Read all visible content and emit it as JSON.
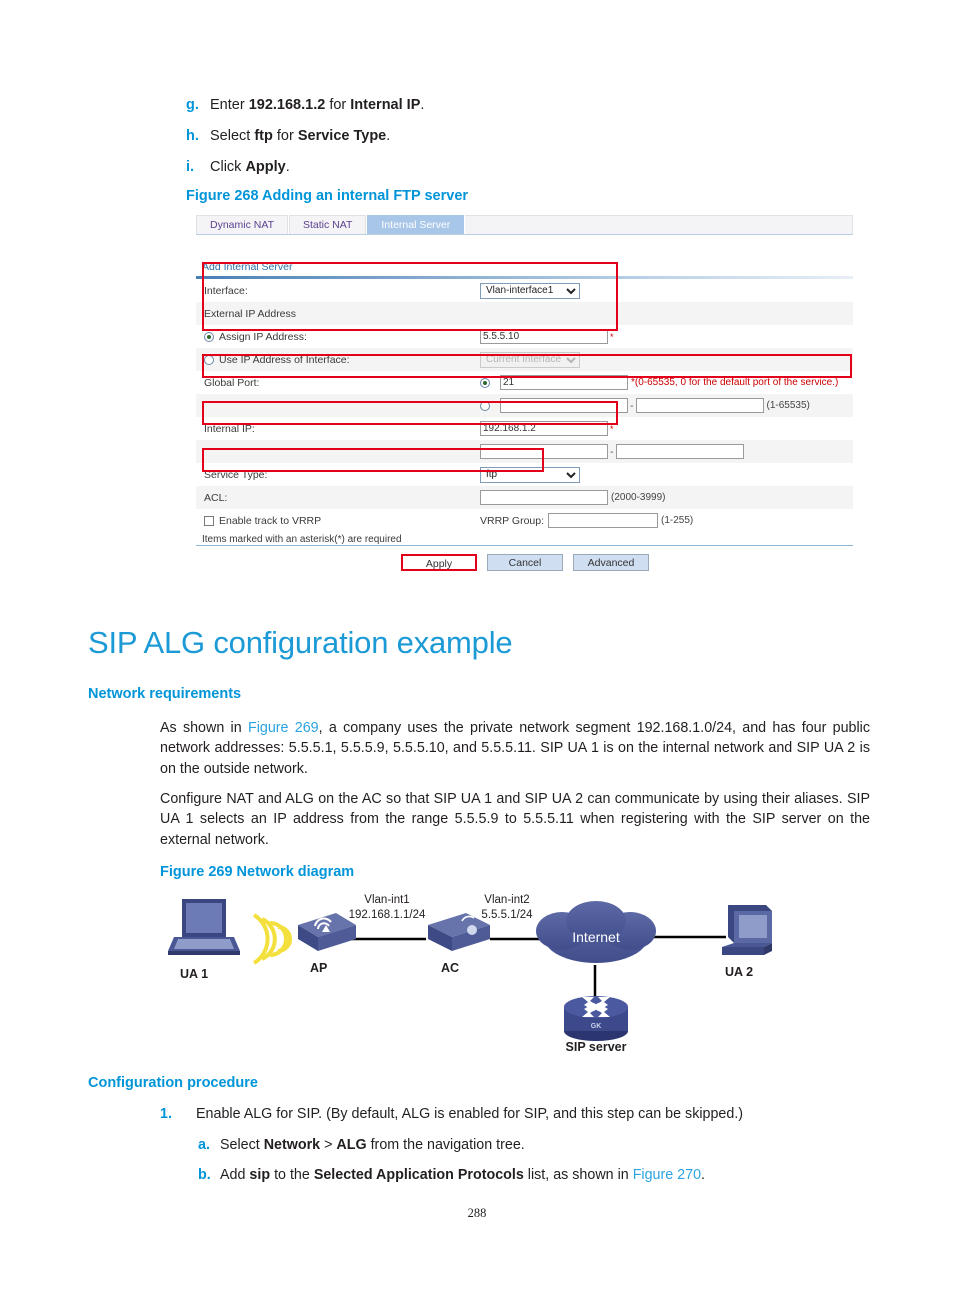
{
  "steps": [
    {
      "alpha": "g.",
      "parts": [
        {
          "t": "Enter ",
          "b": false
        },
        {
          "t": "192.168.1.2",
          "b": true
        },
        {
          "t": " for ",
          "b": false
        },
        {
          "t": "Internal IP",
          "b": true
        },
        {
          "t": ".",
          "b": false
        }
      ]
    },
    {
      "alpha": "h.",
      "parts": [
        {
          "t": "Select ",
          "b": false
        },
        {
          "t": "ftp",
          "b": true
        },
        {
          "t": " for ",
          "b": false
        },
        {
          "t": "Service Type",
          "b": true
        },
        {
          "t": ".",
          "b": false
        }
      ]
    },
    {
      "alpha": "i.",
      "parts": [
        {
          "t": "Click ",
          "b": false
        },
        {
          "t": "Apply",
          "b": true
        },
        {
          "t": ".",
          "b": false
        }
      ]
    }
  ],
  "figure268": {
    "caption": "Figure 268 Adding an internal FTP server",
    "tabs": [
      {
        "label": "Dynamic NAT",
        "active": false
      },
      {
        "label": "Static NAT",
        "active": false
      },
      {
        "label": "Internal Server",
        "active": true
      }
    ],
    "section_title": "Add Internal Server",
    "rows": {
      "interface_label": "Interface:",
      "interface_value": "Vlan-interface1",
      "external_ip_label": "External IP Address",
      "assign_ip_label": "Assign IP Address:",
      "assign_ip_value": "5.5.5.10",
      "use_ip_of_interface_label": "Use IP Address of Interface:",
      "current_interface_value": "Current Interface",
      "global_port_label": "Global Port:",
      "global_port_value": "21",
      "global_port_hint": "*(0-65535, 0 for the default port of the service.)",
      "port_range_hint": "(1-65535)",
      "port_range_from": "",
      "port_range_to": "",
      "internal_ip_label": "Internal IP:",
      "internal_ip_value": "192.168.1.2",
      "internal_ip_range_from": "",
      "internal_ip_range_to": "",
      "service_type_label": "Service Type:",
      "service_type_value": "ftp",
      "acl_label": "ACL:",
      "acl_value": "",
      "acl_hint": "(2000-3999)",
      "enable_track_vrrp_label": "Enable track to VRRP",
      "vrrp_group_label": "VRRP Group:",
      "vrrp_group_value": "",
      "vrrp_group_hint": "(1-255)"
    },
    "footnote": "Items marked with an asterisk(*) are required",
    "buttons": {
      "apply": "Apply",
      "cancel": "Cancel",
      "advanced": "Advanced"
    }
  },
  "chapter_title": "SIP ALG configuration example",
  "network_requirements": {
    "heading": "Network requirements",
    "p1_a": "As shown in ",
    "p1_link": "Figure 269",
    "p1_b": ", a company uses the private network segment 192.168.1.0/24, and has four public network addresses: 5.5.5.1, 5.5.5.9, 5.5.5.10, and 5.5.5.11. SIP UA 1 is on the internal network and SIP UA 2 is on the outside network.",
    "p2": "Configure NAT and ALG on the AC so that SIP UA 1 and SIP UA 2 can communicate by using their aliases. SIP UA 1 selects an IP address from the range 5.5.5.9 to 5.5.5.11 when registering with the SIP server on the external network."
  },
  "figure269": {
    "caption": "Figure 269 Network diagram",
    "nodes": {
      "ua1": "UA 1",
      "ap": "AP",
      "ac": "AC",
      "internet": "Internet",
      "ua2": "UA 2",
      "sip_server": "SIP server",
      "sip_server_badge": "GK"
    },
    "links": {
      "vlan_int1_name": "Vlan-int1",
      "vlan_int1_addr": "192.168.1.1/24",
      "vlan_int2_name": "Vlan-int2",
      "vlan_int2_addr": "5.5.5.1/24"
    }
  },
  "configuration_procedure": {
    "heading": "Configuration procedure",
    "step1_num": "1.",
    "step1_text": "Enable ALG for SIP. (By default, ALG is enabled for SIP, and this step can be skipped.)",
    "sub_a_alpha": "a.",
    "sub_a_parts": [
      {
        "t": "Select ",
        "b": false
      },
      {
        "t": "Network",
        "b": true
      },
      {
        "t": " > ",
        "b": false
      },
      {
        "t": "ALG",
        "b": true
      },
      {
        "t": " from the navigation tree.",
        "b": false
      }
    ],
    "sub_b_alpha": "b.",
    "sub_b_parts": [
      {
        "t": "Add ",
        "b": false
      },
      {
        "t": "sip",
        "b": true
      },
      {
        "t": " to the ",
        "b": false
      },
      {
        "t": "Selected Application Protocols",
        "b": true
      },
      {
        "t": " list, as shown in ",
        "b": false
      }
    ],
    "sub_b_link": "Figure 270",
    "sub_b_tail": "."
  },
  "page_number": "288",
  "colors": {
    "accent_blue": "#0095d9",
    "heading_blue": "#1b9ad6",
    "link_blue": "#2aa3e0",
    "highlight_red": "#e2001a",
    "tab_active": "#a8c6e8",
    "node_blue": "#46538f"
  }
}
